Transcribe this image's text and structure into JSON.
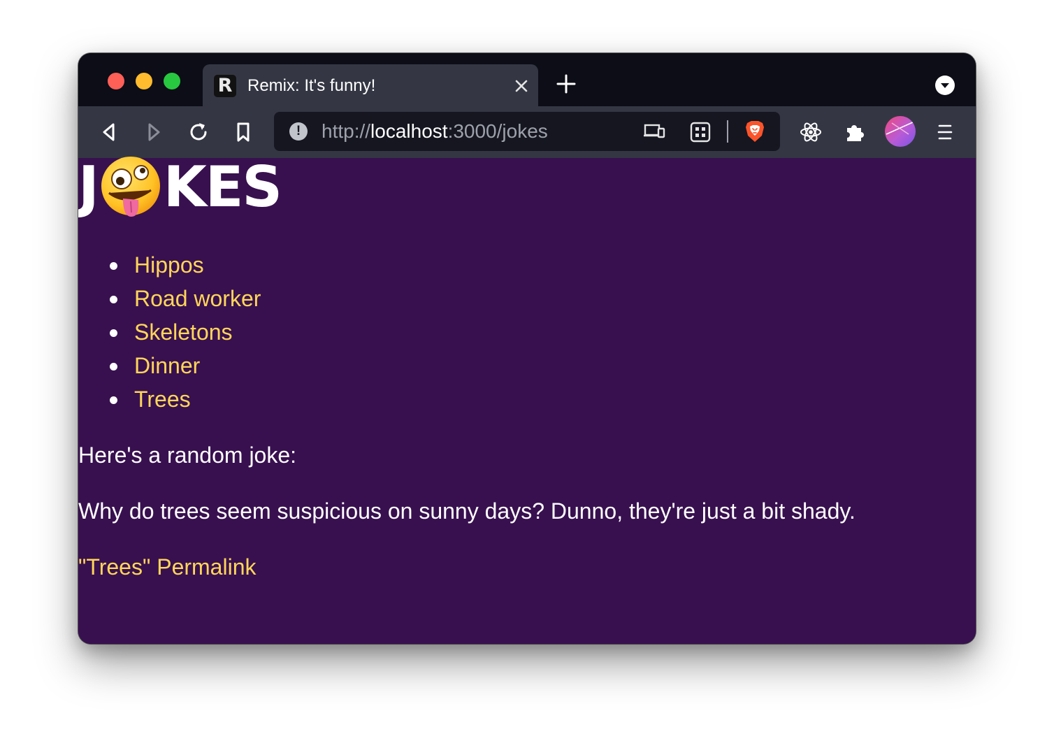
{
  "browser": {
    "tab": {
      "favicon": "remix-logo-icon",
      "title": "Remix: It's funny!"
    },
    "address": {
      "scheme": "http://",
      "host": "localhost",
      "rest": ":3000/jokes"
    }
  },
  "page": {
    "logo": {
      "left_text": "J",
      "right_text": "KES",
      "emoji": "zany-face-icon"
    },
    "jokes": [
      {
        "label": "Hippos"
      },
      {
        "label": "Road worker"
      },
      {
        "label": "Skeletons"
      },
      {
        "label": "Dinner"
      },
      {
        "label": "Trees"
      }
    ],
    "random_heading": "Here's a random joke:",
    "joke_text": "Why do trees seem suspicious on sunny days? Dunno, they're just a bit shady.",
    "permalink": "\"Trees\" Permalink"
  },
  "colors": {
    "page_background": "#38104f",
    "link": "#ffd65a",
    "tab_active": "#343743",
    "tabstrip": "#0c0d16"
  }
}
